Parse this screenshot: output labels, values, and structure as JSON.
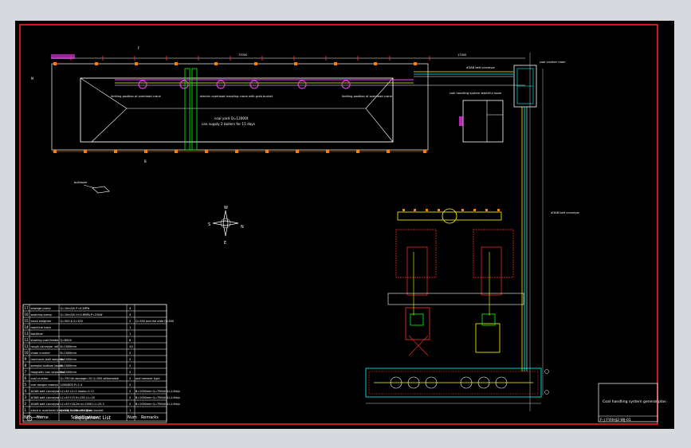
{
  "drawing": {
    "compass": {
      "n": "N",
      "s": "S",
      "e": "E",
      "w": "W"
    },
    "title_block": {
      "title": "Coal handling system general plan",
      "drawing_no": "F-J   FYHHJ2-WJ-01"
    },
    "equipment_list": {
      "caption": "Equipment List",
      "headers": [
        "NO.",
        "Name",
        "Specifications",
        "Num",
        "Remarks"
      ],
      "rows": [
        {
          "no": "17",
          "name": "sewage pump",
          "spec": "Q=10m3/h  P=0.2MPa",
          "num": "4",
          "remarks": ""
        },
        {
          "no": "16",
          "name": "washing pump",
          "spec": "Q=10m3/h  H=0.8MPa  P=22kW",
          "num": "4",
          "remarks": ""
        },
        {
          "no": "15",
          "name": "track weighter",
          "spec": "Q=500 & 0=100",
          "num": "2",
          "remarks": "Q=500 and the slide Q=500"
        },
        {
          "no": "14",
          "name": "machine track",
          "spec": "",
          "num": "1",
          "remarks": ""
        },
        {
          "no": "13",
          "name": "backhoe",
          "spec": "",
          "num": "1",
          "remarks": ""
        },
        {
          "no": "12",
          "name": "shaking coal feeder",
          "spec": "Q=80t/h",
          "num": "8",
          "remarks": ""
        },
        {
          "no": "11",
          "name": "rough conveyor roll",
          "spec": "B=1000mm",
          "num": "10",
          "remarks": ""
        },
        {
          "no": "10",
          "name": "chain crusher",
          "spec": "B=1000mm",
          "num": "2",
          "remarks": ""
        },
        {
          "no": "9",
          "name": "mechanic belt weighter",
          "spec": "B=1000mm",
          "num": "2",
          "remarks": ""
        },
        {
          "no": "8",
          "name": "sampler bottom board",
          "spec": "B=1000mm",
          "num": "2",
          "remarks": ""
        },
        {
          "no": "7",
          "name": "magnetic iron separator",
          "spec": "B=1000mm",
          "num": "2",
          "remarks": ""
        },
        {
          "no": "6",
          "name": "coal crusher",
          "spec": "Q=750 t/h  damage=15  Q=500 deformable",
          "num": "2",
          "remarks": "and hammer type"
        },
        {
          "no": "5",
          "name": "one danger reamer",
          "spec": "1000/800  P=1.5",
          "num": "2",
          "remarks": ""
        },
        {
          "no": "4",
          "name": "#2AB belt conveyor",
          "spec": "L1=40  L2=1  hooks=1+2",
          "num": "2",
          "remarks": "B=1000mm  Q=750t/h  V=1.6m/s"
        },
        {
          "no": "3",
          "name": "#3AB belt conveyor",
          "spec": "L1=40+15  H=250  L1=20",
          "num": "2",
          "remarks": "B=1000mm  Q=750t/h  V=1.6m/s"
        },
        {
          "no": "2",
          "name": "#4AB belt conveyor",
          "spec": "L1=40+18.2m  b=1000  L1=25.3",
          "num": "2",
          "remarks": "B=1000mm  Q=750t/h  V=1.6m/s"
        },
        {
          "no": "1",
          "name": "electric overhead traveling crane with grab bucket",
          "spec": "Q=10t  S=28m  H=30m",
          "num": "1",
          "remarks": ""
        }
      ]
    },
    "annotations": {
      "yard_center": "coal yard Q=12000t",
      "yard_center_2": "can supply 2 boilers for 15 days",
      "crane_left": "limiting position of overhead crane",
      "crane_mid": "electric overhead traveling crane with grab bucket",
      "crane_right": "limiting position of overhead crane",
      "crusher_room": "coal crusher room",
      "conveyor_top": "#3AB belt conveyor",
      "conveyor_right": "#3AB belt conveyor",
      "control_room": "coal handling system watchful room",
      "bulldozer": "bulldozer",
      "grid_top": "F",
      "grid_left": "N",
      "grid_bottom": "B"
    }
  }
}
